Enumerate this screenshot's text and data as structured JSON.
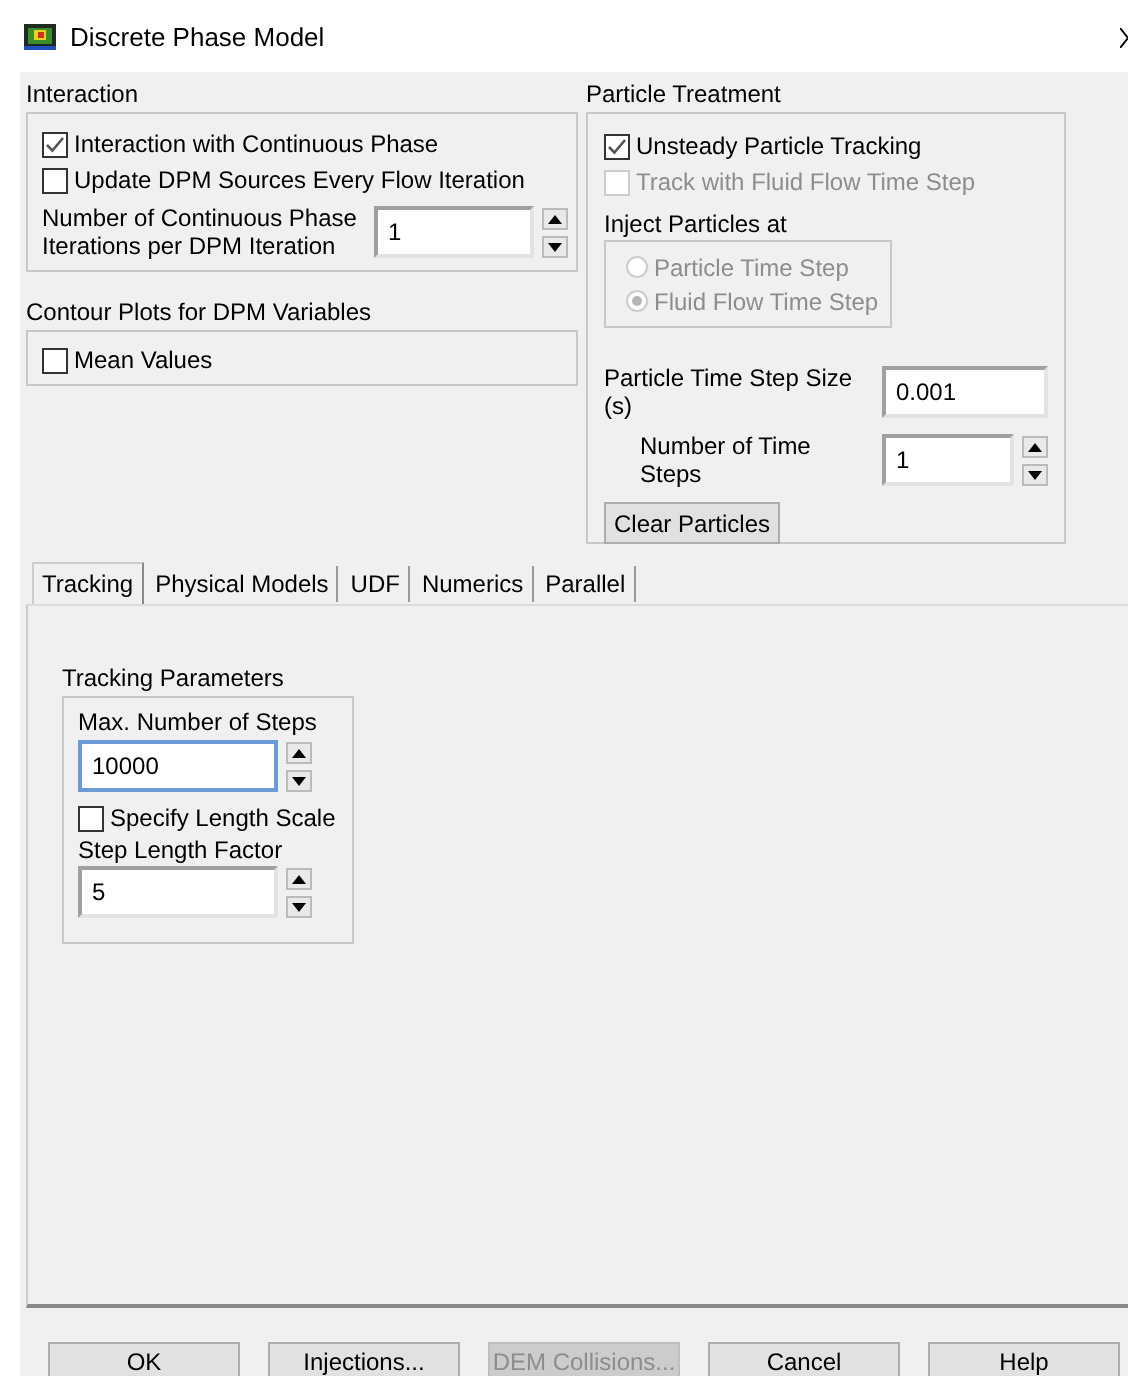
{
  "window": {
    "title": "Discrete Phase Model"
  },
  "interaction": {
    "title": "Interaction",
    "options": [
      {
        "label": "Interaction with Continuous Phase",
        "checked": true,
        "disabled": false
      },
      {
        "label": "Update DPM Sources Every Flow Iteration",
        "checked": false,
        "disabled": false
      }
    ],
    "iterations": {
      "label": "Number of Continuous Phase Iterations per DPM Iteration",
      "value": "1",
      "focused": false
    }
  },
  "contour_plots": {
    "title": "Contour Plots for DPM Variables",
    "options": [
      {
        "label": "Mean Values",
        "checked": false,
        "disabled": false
      }
    ]
  },
  "particle_treatment": {
    "title": "Particle Treatment",
    "options": [
      {
        "label": "Unsteady Particle Tracking",
        "checked": true,
        "disabled": false
      },
      {
        "label": "Track with Fluid Flow Time Step",
        "checked": false,
        "disabled": true
      }
    ],
    "inject": {
      "title": "Inject Particles at",
      "disabled": true,
      "options": [
        {
          "label": "Particle Time Step",
          "selected": false
        },
        {
          "label": "Fluid Flow Time Step",
          "selected": true
        }
      ]
    },
    "step_size": {
      "label": "Particle Time Step Size (s)",
      "value": "0.001",
      "focused": false
    },
    "time_steps": {
      "label": "Number of Time Steps",
      "value": "1",
      "focused": false
    },
    "clear_button": {
      "label": "Clear Particles",
      "disabled": false
    }
  },
  "tabs": [
    {
      "label": "Tracking",
      "selected": true
    },
    {
      "label": "Physical Models",
      "selected": false
    },
    {
      "label": "UDF",
      "selected": false
    },
    {
      "label": "Numerics",
      "selected": false
    },
    {
      "label": "Parallel",
      "selected": false
    }
  ],
  "tracking_parameters": {
    "title": "Tracking Parameters",
    "max_steps": {
      "label": "Max. Number of Steps",
      "value": "10000",
      "focused": true
    },
    "specify_length_scale": {
      "label": "Specify Length Scale",
      "checked": false,
      "disabled": false
    },
    "step_length_factor": {
      "label": "Step Length Factor",
      "value": "5",
      "focused": false
    }
  },
  "buttons": [
    {
      "label": "OK",
      "disabled": false
    },
    {
      "label": "Injections...",
      "disabled": false
    },
    {
      "label": "DEM Collisions...",
      "disabled": true
    },
    {
      "label": "Cancel",
      "disabled": false
    },
    {
      "label": "Help",
      "disabled": false
    }
  ]
}
